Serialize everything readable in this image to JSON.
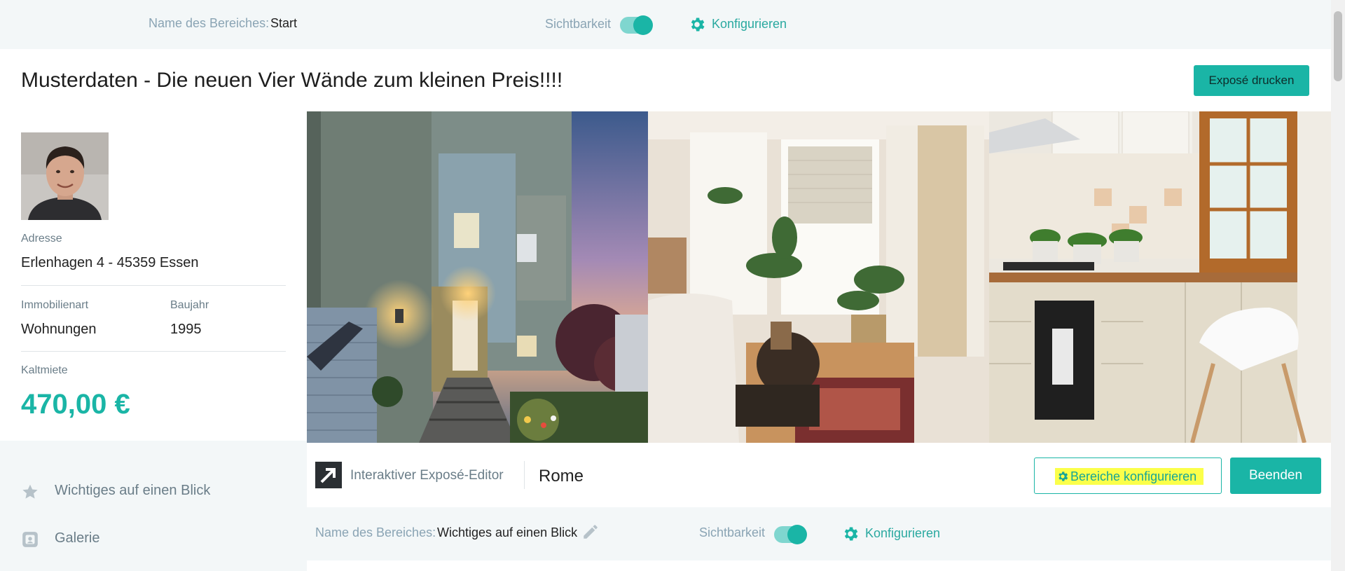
{
  "topbar": {
    "area_name_label": "Name des Bereiches:",
    "area_name_value": "Start",
    "visibility_label": "Sichtbarkeit",
    "visibility_on": true,
    "configure_label": "Konfigurieren"
  },
  "header": {
    "title": "Musterdaten - Die neuen Vier Wände zum kleinen Preis!!!!",
    "print_button": "Exposé drucken"
  },
  "property": {
    "address_label": "Adresse",
    "address_value": "Erlenhagen 4 - 45359 Essen",
    "type_label": "Immobilienart",
    "type_value": "Wohnungen",
    "year_label": "Baujahr",
    "year_value": "1995",
    "rent_label": "Kaltmiete",
    "rent_value": "470,00 €"
  },
  "nav": {
    "items": [
      {
        "label": "Wichtiges auf einen Blick",
        "icon": "star-icon"
      },
      {
        "label": "Galerie",
        "icon": "gallery-icon"
      }
    ]
  },
  "editor": {
    "name": "Interaktiver Exposé-Editor",
    "theme": "Rome",
    "configure_areas_button": "Bereiche konfigurieren",
    "finish_button": "Beenden"
  },
  "section": {
    "area_name_label": "Name des Bereiches:",
    "area_name_value": "Wichtiges auf einen Blick",
    "visibility_label": "Sichtbarkeit",
    "visibility_on": true,
    "configure_label": "Konfigurieren"
  },
  "colors": {
    "accent": "#1ab5a6",
    "highlight": "#fbff4a",
    "muted_text": "#6a7d88",
    "page_bg": "#f3f7f8"
  }
}
